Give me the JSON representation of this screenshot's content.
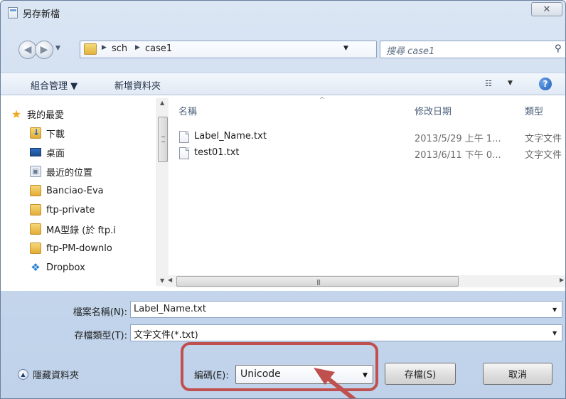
{
  "window": {
    "title": "另存新檔",
    "close_glyph": "✕"
  },
  "address": {
    "segments": [
      "sch",
      "case1"
    ],
    "search_placeholder": "搜尋 case1"
  },
  "toolbar": {
    "organize": "組合管理 ▼",
    "new_folder": "新增資料夾"
  },
  "sidebar": {
    "items": [
      {
        "label": "我的最愛",
        "icon": "star-icon"
      },
      {
        "label": "下載",
        "icon": "downloads-folder-icon"
      },
      {
        "label": "桌面",
        "icon": "desktop-icon"
      },
      {
        "label": "最近的位置",
        "icon": "recent-places-icon"
      },
      {
        "label": "Banciao-Eva",
        "icon": "folder-icon"
      },
      {
        "label": "ftp-private",
        "icon": "folder-icon"
      },
      {
        "label": "MA型錄 (於 ftp.i",
        "icon": "folder-icon"
      },
      {
        "label": "ftp-PM-downlo",
        "icon": "folder-icon"
      },
      {
        "label": "Dropbox",
        "icon": "dropbox-icon"
      }
    ]
  },
  "file_list": {
    "columns": [
      "名稱",
      "修改日期",
      "類型"
    ],
    "rows": [
      {
        "name": "Label_Name.txt",
        "date": "2013/5/29 上午 1...",
        "type": "文字文件"
      },
      {
        "name": "test01.txt",
        "date": "2013/6/11 下午 0...",
        "type": "文字文件"
      }
    ]
  },
  "form": {
    "filename_label": "檔案名稱(N):",
    "filename_value": "Label_Name.txt",
    "filetype_label": "存檔類型(T):",
    "filetype_value": "文字文件(*.txt)",
    "hide_folders": "隱藏資料夾",
    "encoding_label": "編碼(E):",
    "encoding_value": "Unicode",
    "save_button": "存檔(S)",
    "cancel_button": "取消"
  },
  "annotation": {
    "color": "#c0504d"
  }
}
